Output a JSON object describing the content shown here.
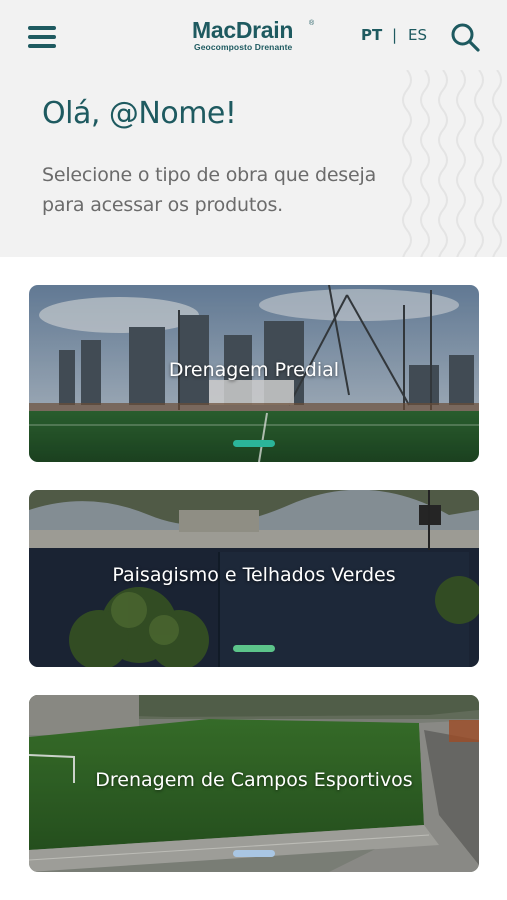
{
  "header": {
    "logo_main": "MacDrain",
    "logo_registered": "®",
    "logo_sub": "Geocomposto Drenante",
    "lang_pt": "PT",
    "lang_separator": "|",
    "lang_es": "ES",
    "menu_icon": "hamburger-menu-icon",
    "search_icon": "magnifier-icon"
  },
  "welcome": {
    "greeting": "Olá, @Nome!",
    "subtitle": "Selecione o tipo de obra que deseja para acessar os produtos."
  },
  "cards": [
    {
      "title": "Drenagem Predial",
      "indicator_color": "#2bb59a"
    },
    {
      "title": "Paisagismo e Telhados Verdes",
      "indicator_color": "#5cc48a"
    },
    {
      "title": "Drenagem de Campos Esportivos",
      "indicator_color": "#a9c6e3"
    }
  ],
  "colors": {
    "brand": "#1e5a60",
    "header_bg": "#f2f2f2",
    "subtitle_text": "#6b6b6b"
  }
}
